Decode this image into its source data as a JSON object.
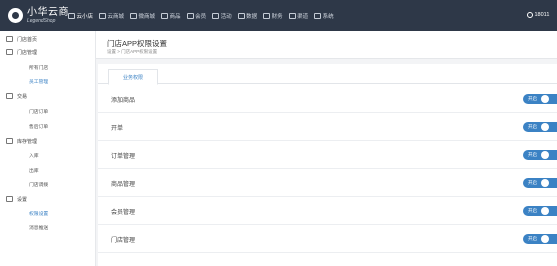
{
  "header": {
    "logo_cn": "小华云商",
    "logo_en": "LegendShop",
    "nav": [
      {
        "label": "云小店",
        "icon": "store-icon",
        "active": true
      },
      {
        "label": "云商城",
        "icon": "home-icon"
      },
      {
        "label": "微商城",
        "icon": "home-icon"
      },
      {
        "label": "商品",
        "icon": "bag-icon"
      },
      {
        "label": "会员",
        "icon": "user-icon"
      },
      {
        "label": "活动",
        "icon": "chat-icon"
      },
      {
        "label": "数据",
        "icon": "chart-icon"
      },
      {
        "label": "财务",
        "icon": "person-icon"
      },
      {
        "label": "渠道",
        "icon": "channel-icon"
      },
      {
        "label": "系统",
        "icon": "gear-icon"
      }
    ],
    "user": "18011"
  },
  "sidebar": {
    "items": [
      {
        "label": "门店首页",
        "type": "group",
        "icon": "home-icon"
      },
      {
        "label": "门店管理",
        "type": "group",
        "icon": "store-icon"
      },
      {
        "label": "所有门店",
        "type": "sub"
      },
      {
        "label": "员工管理",
        "type": "sub",
        "selected": true
      },
      {
        "label": "交易",
        "type": "group",
        "icon": "document-icon"
      },
      {
        "label": "门店订单",
        "type": "sub"
      },
      {
        "label": "售后订单",
        "type": "sub"
      },
      {
        "label": "库存管理",
        "type": "group",
        "icon": "box-icon"
      },
      {
        "label": "入库",
        "type": "sub"
      },
      {
        "label": "出库",
        "type": "sub"
      },
      {
        "label": "门店调拨",
        "type": "sub"
      },
      {
        "label": "设置",
        "type": "group",
        "icon": "gear-icon"
      },
      {
        "label": "权限设置",
        "type": "sub",
        "selected": true
      },
      {
        "label": "消息推送",
        "type": "sub"
      }
    ]
  },
  "page": {
    "title": "门店APP权限设置",
    "breadcrumb": "设置 > 门店APP权限设置",
    "tab": "业务权限"
  },
  "permissions": [
    {
      "label": "添加商品",
      "toggle": "开启"
    },
    {
      "label": "开单",
      "toggle": "开启"
    },
    {
      "label": "订单管理",
      "toggle": "开启"
    },
    {
      "label": "商品管理",
      "toggle": "开启"
    },
    {
      "label": "会员管理",
      "toggle": "开启"
    },
    {
      "label": "门店管理",
      "toggle": "开启"
    }
  ],
  "colors": {
    "topbar": "#2e3848",
    "accent": "#3b82c4"
  }
}
